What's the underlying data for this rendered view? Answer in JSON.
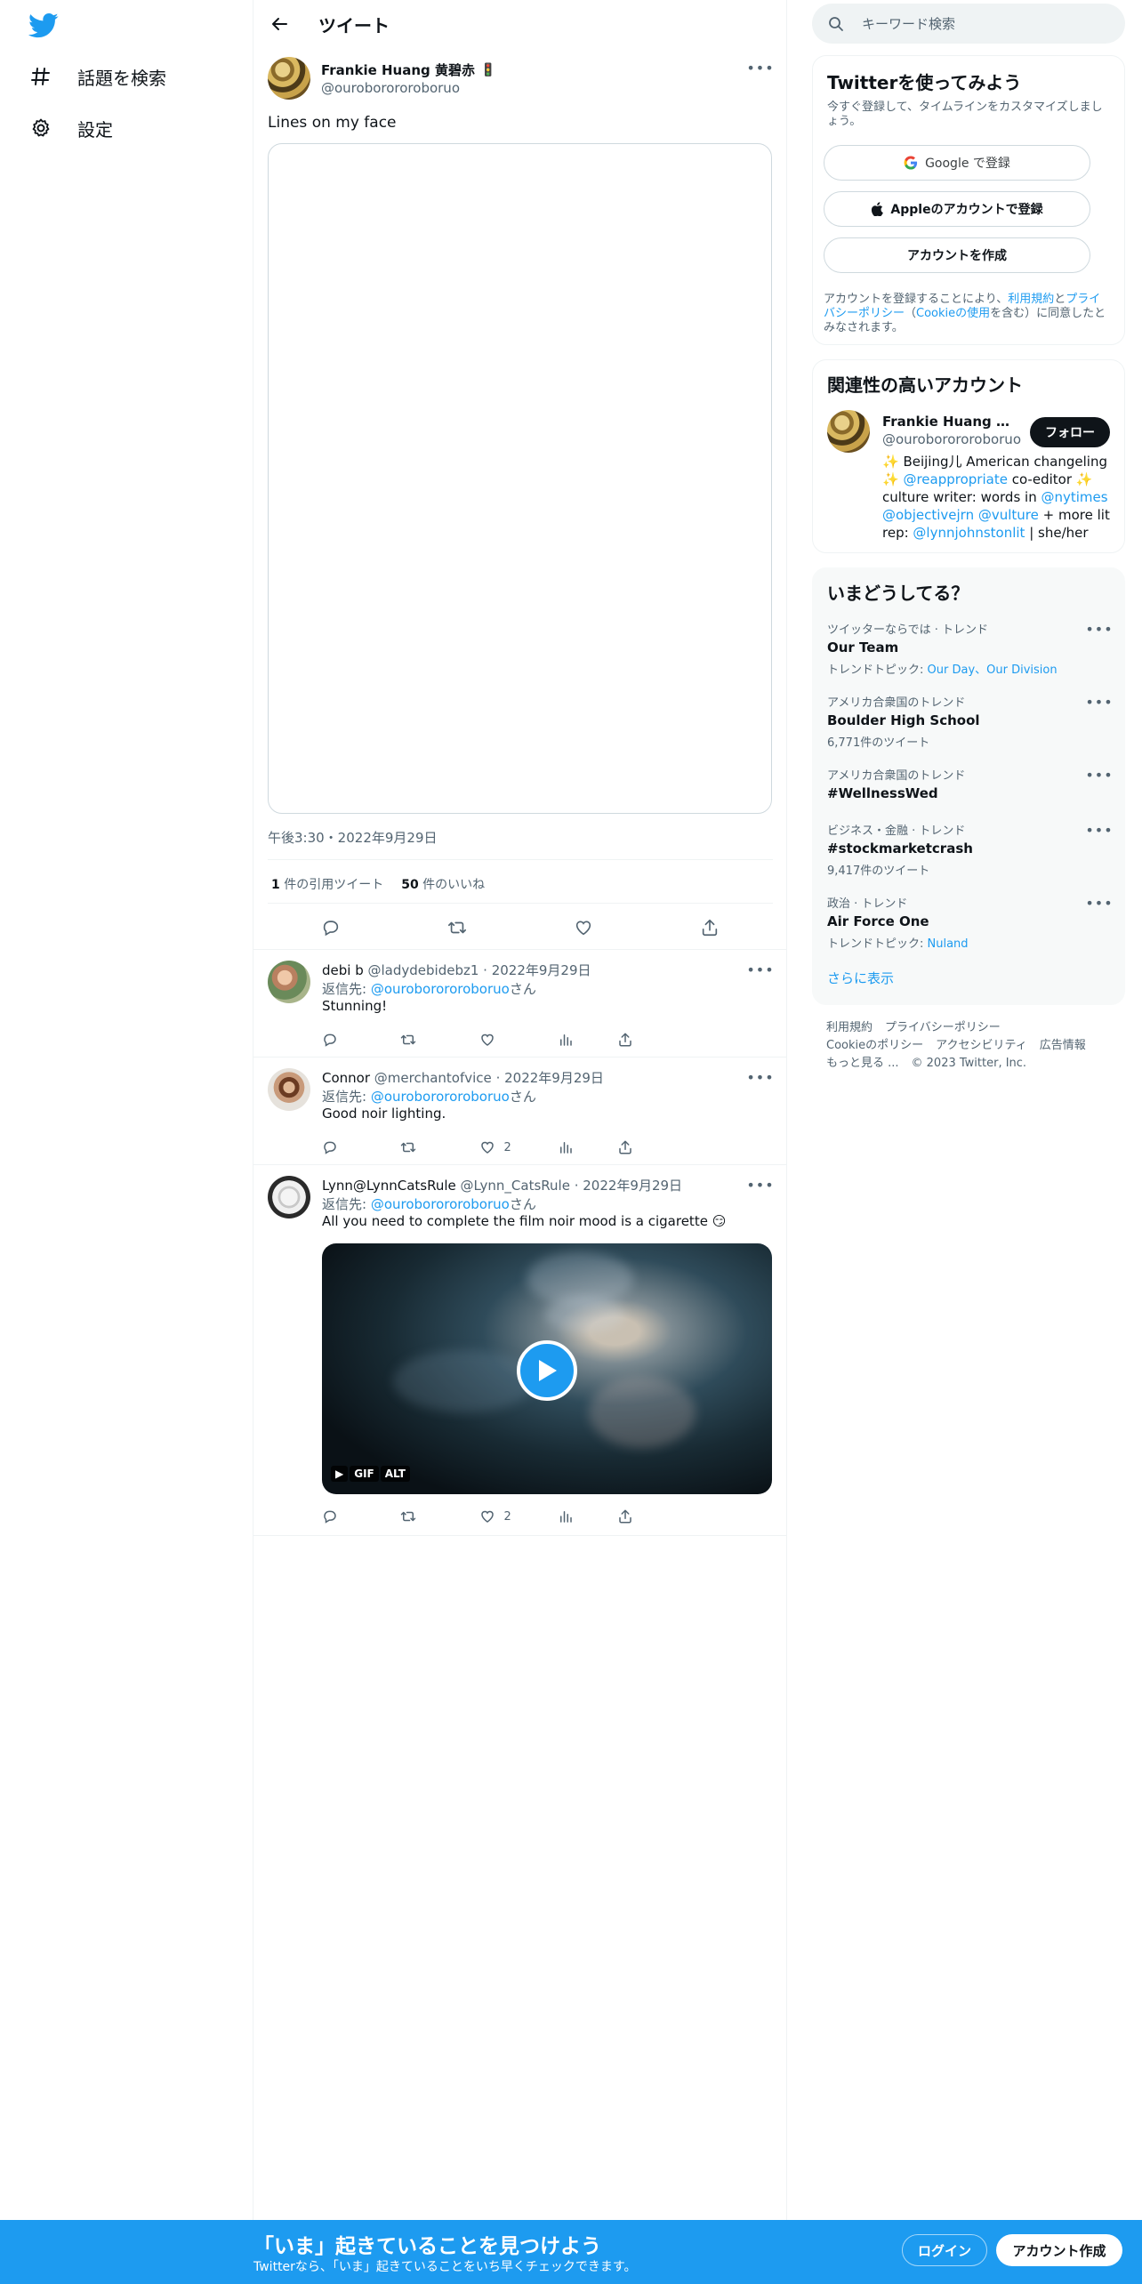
{
  "nav": {
    "logo_icon": "twitter-bird-icon",
    "items": [
      {
        "label": "話題を検索",
        "icon": "hashtag-icon"
      },
      {
        "label": "設定",
        "icon": "gear-icon"
      }
    ]
  },
  "header": {
    "title": "ツイート"
  },
  "main_tweet": {
    "name": "Frankie Huang 黄碧赤",
    "emoji": "🚦",
    "handle": "@ouroborororoboruo",
    "text": "Lines on my face",
    "time": "午後3:30・2022年9月29日",
    "quote_count": "1",
    "quote_label": "件の引用ツイート",
    "like_count": "50",
    "like_label": "件のいいね"
  },
  "replies": [
    {
      "name": "debi b",
      "handle": "@ladydebidebz1",
      "date": "2022年9月29日",
      "reply_prefix": "返信先: ",
      "reply_to": "@ouroborororoboruo",
      "reply_suffix": "さん",
      "text": "Stunning!",
      "likes": ""
    },
    {
      "name": "Connor",
      "handle": "@merchantofvice",
      "date": "2022年9月29日",
      "reply_prefix": "返信先: ",
      "reply_to": "@ouroborororoboruo",
      "reply_suffix": "さん",
      "text": "Good noir lighting.",
      "likes": "2"
    },
    {
      "name": "Lynn@LynnCatsRule",
      "handle": "@Lynn_CatsRule",
      "date": "2022年9月29日",
      "reply_prefix": "返信先: ",
      "reply_to": "@ouroborororoboruo",
      "reply_suffix": "さん",
      "text": "All you need to complete the film noir mood is a cigarette 😏",
      "likes": "2",
      "gif_badge": "GIF",
      "alt_badge": "ALT"
    }
  ],
  "search": {
    "placeholder": "キーワード検索"
  },
  "signup": {
    "title": "Twitterを使ってみよう",
    "subtitle": "今すぐ登録して、タイムラインをカスタマイズしましょう。",
    "google_label": "Google で登録",
    "apple_label": "Appleのアカウントで登録",
    "create_label": "アカウントを作成",
    "legal_1": "アカウントを登録することにより、",
    "legal_terms": "利用規約",
    "legal_2": "と",
    "legal_privacy": "プライバシーポリシー",
    "legal_3": "（",
    "legal_cookie": "Cookieの使用",
    "legal_4": "を含む）に同意したとみなされます。"
  },
  "related": {
    "title": "関連性の高いアカウント",
    "name": "Frankie Huang 黄碧...",
    "handle": "@ouroborororoboruo",
    "follow_label": "フォロー",
    "bio_1": "✨ Beijing儿 American changeling ✨",
    "bio_link1": "@reappropriate",
    "bio_2": " co-editor ✨ culture writer: words in ",
    "bio_link2": "@nytimes",
    "bio_link3": "@objectivejrn",
    "bio_link4": "@vulture",
    "bio_3": " + more lit rep: ",
    "bio_link5": "@lynnjohnstonlit",
    "bio_4": " |  she/her"
  },
  "trends": {
    "title": "いまどうしてる？",
    "items": [
      {
        "context": "ツイッターならでは · トレンド",
        "name": "Our Team",
        "sub_prefix": "トレンドトピック: ",
        "sub_links": "Our Day、Our Division"
      },
      {
        "context": "アメリカ合衆国のトレンド",
        "name": "Boulder High School",
        "sub": "6,771件のツイート"
      },
      {
        "context": "アメリカ合衆国のトレンド",
        "name": "#WellnessWed",
        "sub": ""
      },
      {
        "context": "ビジネス・金融 · トレンド",
        "name": "#stockmarketcrash",
        "sub": "9,417件のツイート"
      },
      {
        "context": "政治 · トレンド",
        "name": "Air Force One",
        "sub_prefix": "トレンドトピック: ",
        "sub_links": "Nuland"
      }
    ],
    "show_more": "さらに表示"
  },
  "footer": {
    "terms": "利用規約",
    "privacy": "プライバシーポリシー",
    "cookie": "Cookieのポリシー",
    "accessibility": "アクセシビリティ",
    "ads": "広告情報",
    "more": "もっと見る ...",
    "copyright": "© 2023 Twitter, Inc."
  },
  "banner": {
    "title": "「いま」起きていることを見つけよう",
    "subtitle": "Twitterなら、「いま」起きていることをいち早くチェックできます。",
    "login_label": "ログイン",
    "signup_label": "アカウント作成"
  },
  "colors": {
    "accent": "#1d9bf0",
    "text": "#0f1419",
    "secondary": "#536471"
  }
}
